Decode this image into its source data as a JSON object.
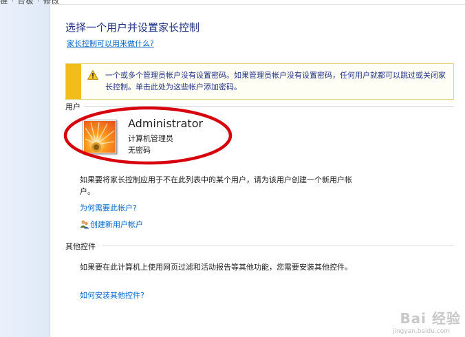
{
  "left_pane": {
    "top_text": "链 · 台板 · 修改"
  },
  "page": {
    "title": "选择一个用户并设置家长控制",
    "help_link": "家长控制可以用来做什么?"
  },
  "warning": {
    "text": "一个或多个管理员帐户没有设置密码。如果管理员帐户没有设置密码，任何用户就都可以跳过或关闭家长控制。单击此处为这些帐户添加密码。"
  },
  "users": {
    "section_label": "用户",
    "account": {
      "name": "Administrator",
      "role": "计算机管理员",
      "password_status": "无密码"
    },
    "new_user_text": "如果要将家长控制应用于不在此列表中的某个用户，请为该用户创建一个新用户帐户。",
    "why_link": "为何需要此帐户?",
    "create_link": "创建新用户帐户"
  },
  "other_controls": {
    "section_label": "其他控件",
    "text": "如果要在此计算机上使用网页过滤和活动报告等其他功能，您需要安装其他控件。",
    "install_link": "如何安装其他控件?"
  },
  "watermark": {
    "text": "Bai 经验",
    "sub": "jingyan.baidu.com"
  },
  "colors": {
    "title": "#1e3287",
    "link": "#0066cc",
    "warning_bar": "#f2bd1a",
    "annotation": "#d8000c"
  },
  "icons": {
    "warning": "warning-triangle-icon",
    "create_user": "users-icon"
  }
}
